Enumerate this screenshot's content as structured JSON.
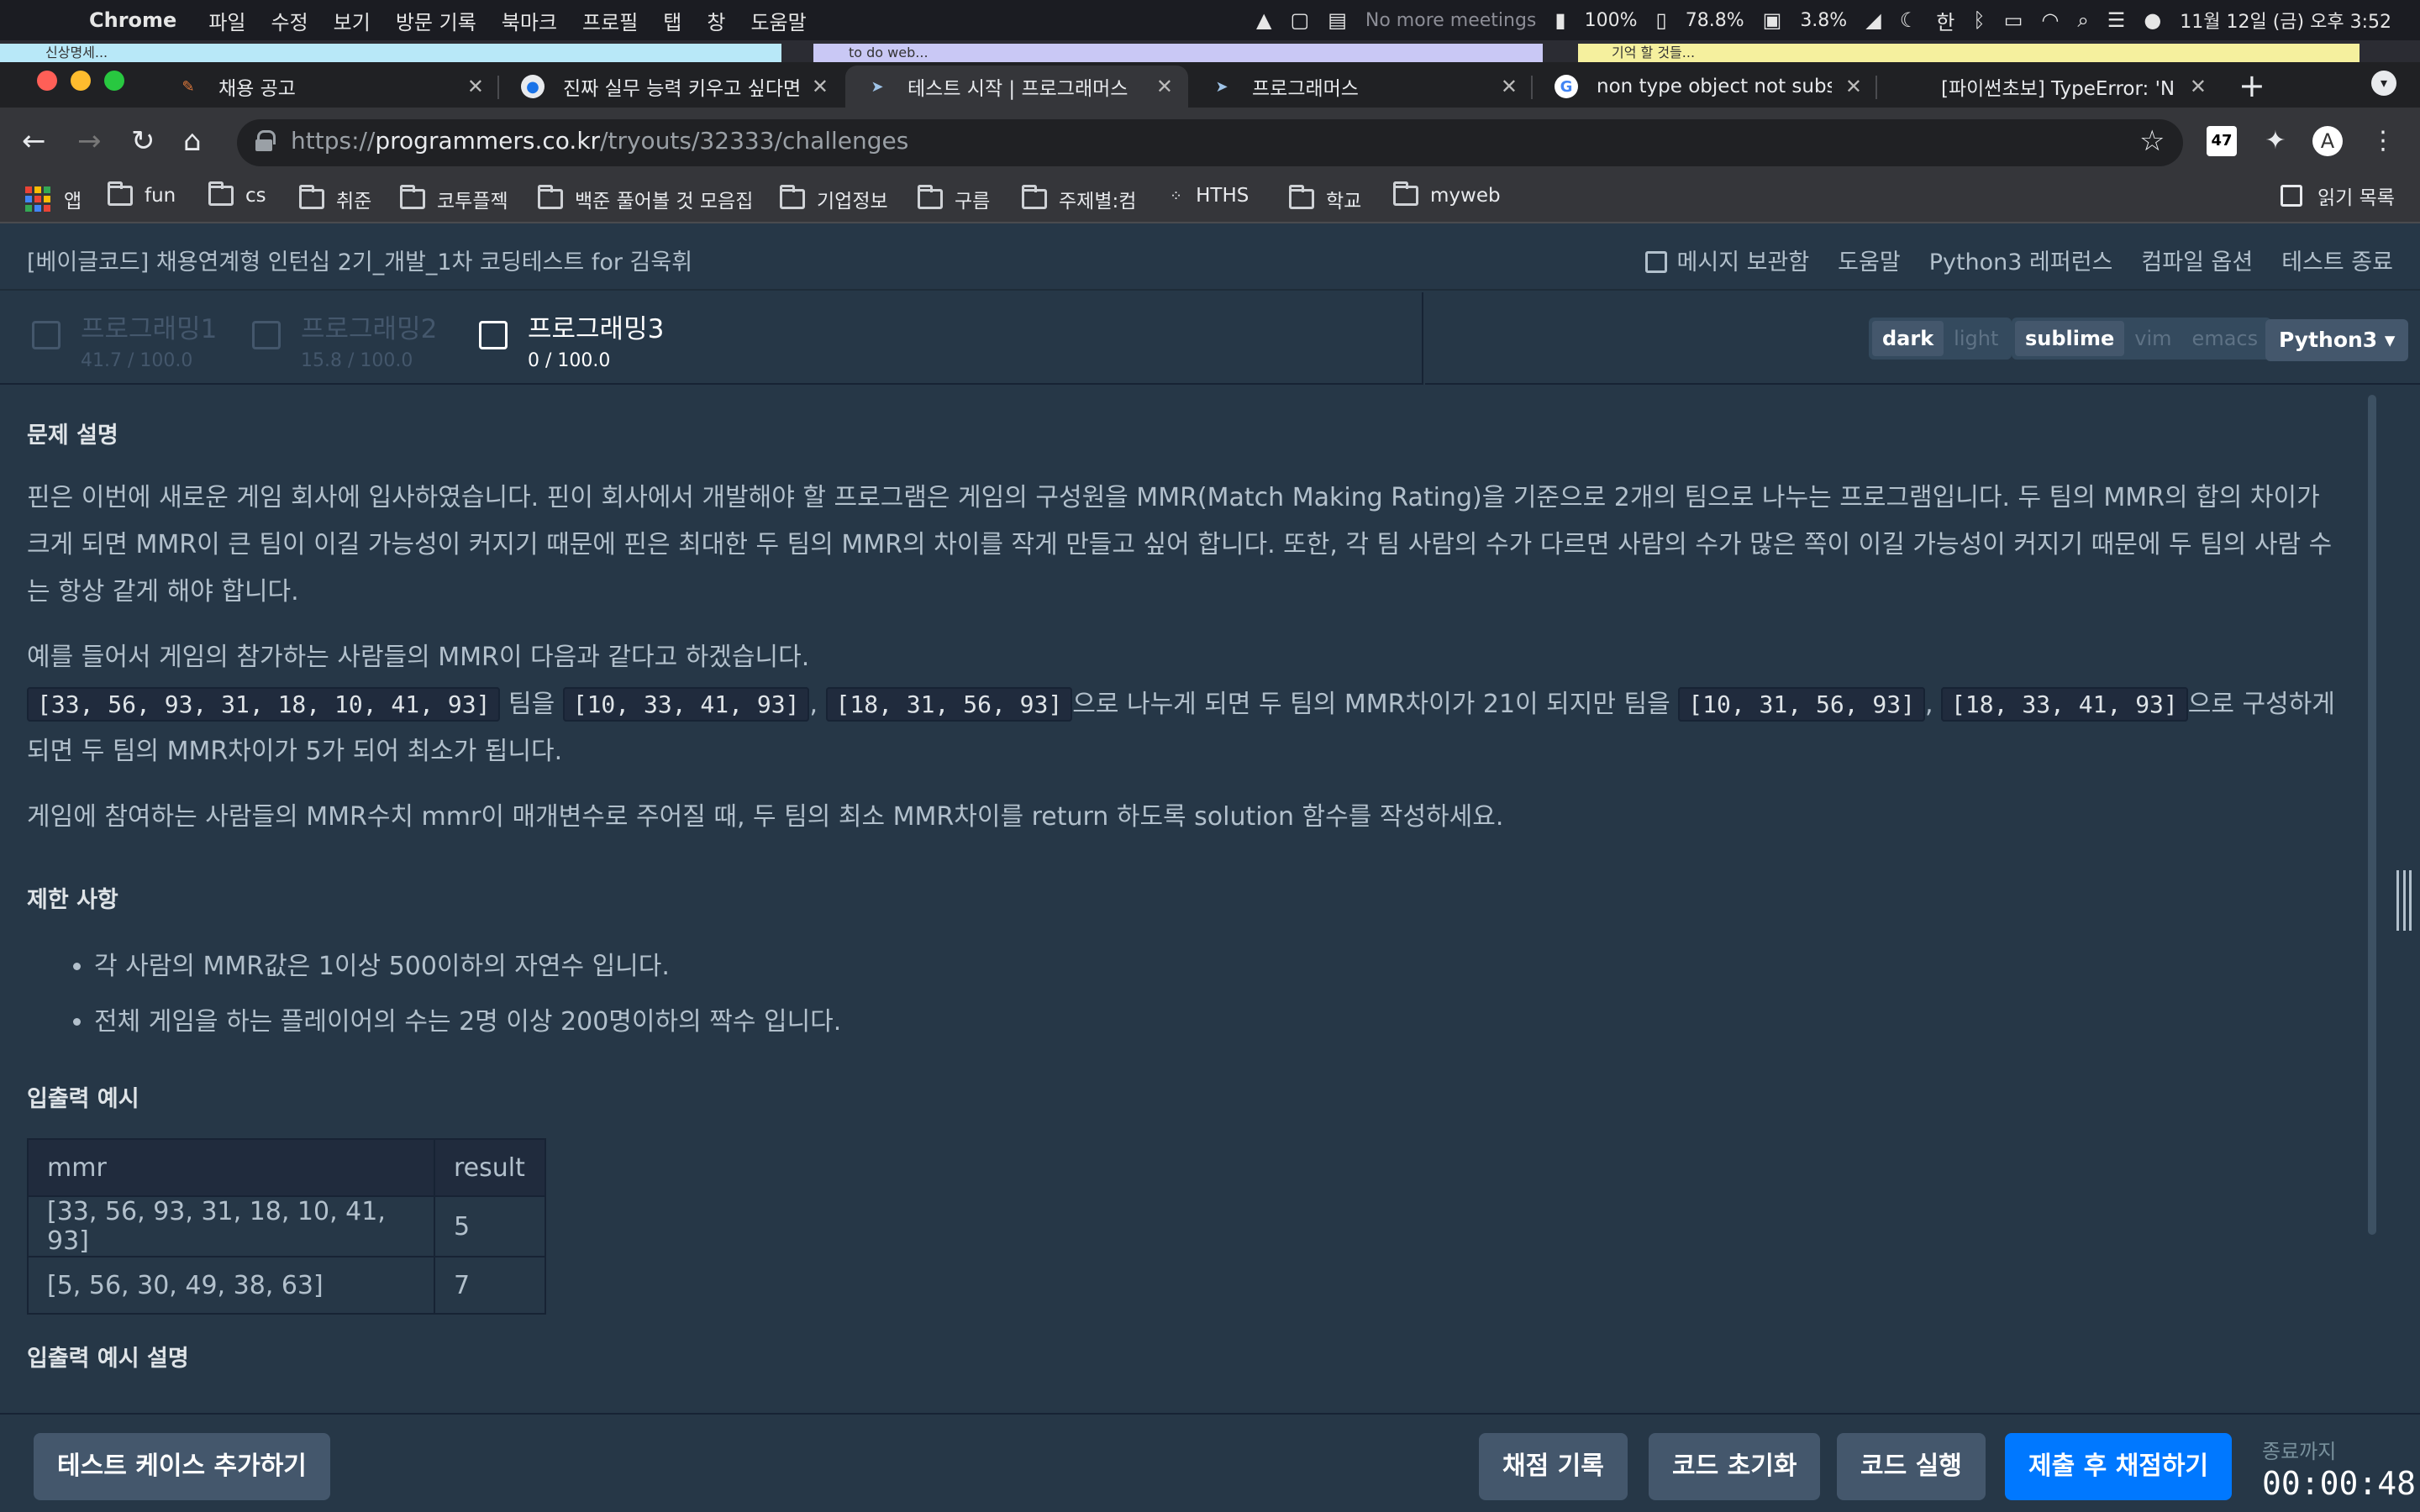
{
  "menubar": {
    "app": "Chrome",
    "items": [
      "파일",
      "수정",
      "보기",
      "방문 기록",
      "북마크",
      "프로필",
      "탭",
      "창",
      "도움말"
    ],
    "meeting_status": "No more meetings",
    "battery_pct": "100%",
    "memory_pct": "78.8%",
    "cpu_pct": "3.8%",
    "input_lang": "한",
    "datetime": "11월 12일 (금) 오후 3:52"
  },
  "stickies": [
    "신상명세...",
    "to do web...",
    "기억 할 것들..."
  ],
  "tabs": [
    {
      "title": "채용 공고",
      "active": false
    },
    {
      "title": "진짜 실무 능력 키우고 싶다면",
      "active": false
    },
    {
      "title": "테스트 시작 | 프로그래머스",
      "active": true
    },
    {
      "title": "프로그래머스",
      "active": false
    },
    {
      "title": "non type object not subs",
      "active": false
    },
    {
      "title": "[파이썬초보] TypeError: 'N",
      "active": false
    }
  ],
  "address": {
    "scheme": "https://",
    "host": "programmers.co.kr",
    "path": "/tryouts/32333/challenges"
  },
  "bookmarks": [
    "앱",
    "fun",
    "cs",
    "취준",
    "코투플젝",
    "백준 풀어볼 것 모음집",
    "기업정보",
    "구름",
    "주제별:컴",
    "HTHS",
    "학교",
    "myweb"
  ],
  "reading_list": "읽기 목록",
  "header": {
    "title": "[베이글코드] 채용연계형 인턴십 2기_개발_1차 코딩테스트 for 김욱휘",
    "links": [
      "메시지 보관함",
      "도움말",
      "Python3 레퍼런스",
      "컴파일 옵션",
      "테스트 종료"
    ]
  },
  "questions": [
    {
      "name": "프로그래밍1",
      "score": "41.7 / 100.0"
    },
    {
      "name": "프로그래밍2",
      "score": "15.8 / 100.0"
    },
    {
      "name": "프로그래밍3",
      "score": "0 / 100.0"
    }
  ],
  "editor": {
    "theme_options": [
      "dark",
      "light"
    ],
    "keymap_options": [
      "sublime",
      "vim",
      "emacs"
    ],
    "language": "Python3 ▾"
  },
  "problem": {
    "section_desc": "문제 설명",
    "para1": "핀은 이번에 새로운 게임 회사에 입사하였습니다. 핀이 회사에서 개발해야 할 프로그램은 게임의 구성원을 MMR(Match Making Rating)을 기준으로 2개의 팀으로 나누는 프로그램입니다. 두 팀의 MMR의 합의 차이가 크게 되면 MMR이 큰 팀이 이길 가능성이 커지기 때문에 핀은 최대한 두 팀의 MMR의 차이를 작게 만들고 싶어 합니다. 또한, 각 팀 사람의 수가 다르면 사람의 수가 많은 쪽이 이길 가능성이 커지기 때문에 두 팀의 사람 수는 항상 같게 해야 합니다.",
    "example_intro": "예를 들어서 게임의 참가하는 사람들의 MMR이 다음과 같다고 하겠습니다.",
    "ex_all": "[33, 56, 93, 31, 18, 10, 41, 93]",
    "ex_t1": " 팀을 ",
    "ex_a": "[10, 33, 41, 93]",
    "comma": ", ",
    "ex_b": "[18, 31, 56, 93]",
    "ex_t2": "으로 나누게 되면 두 팀의 MMR차이가 21이 되지만 팀을 ",
    "ex_c": "[10, 31, 56, 93]",
    "ex_d": "[18, 33, 41, 93]",
    "ex_t3": "으로 구성하게 되면 두 팀의 MMR차이가 5가 되어 최소가 됩니다.",
    "task": "게임에 참여하는 사람들의 MMR수치 mmr이 매개변수로 주어질 때, 두 팀의 최소 MMR차이를 return 하도록 solution 함수를 작성하세요.",
    "section_limits": "제한 사항",
    "limits": [
      "각 사람의 MMR값은 1이상 500이하의 자연수 입니다.",
      "전체 게임을 하는 플레이어의 수는 2명 이상 200명이하의 짝수 입니다."
    ],
    "section_io": "입출력 예시",
    "table_headers": [
      "mmr",
      "result"
    ],
    "table_rows": [
      [
        "[33, 56, 93, 31, 18, 10, 41, 93]",
        "5"
      ],
      [
        "[5, 56, 30, 49, 38, 63]",
        "7"
      ]
    ],
    "section_io_desc": "입출력 예시 설명"
  },
  "footer": {
    "add_case": "테스트 케이스 추가하기",
    "history": "채점 기록",
    "reset": "코드 초기화",
    "run": "코드 실행",
    "submit": "제출 후 채점하기",
    "timer_label": "종료까지",
    "timer": "00:00:48"
  },
  "colors": {
    "background": "#263747",
    "primary_button": "#0078ff",
    "secondary_button": "#44576c"
  }
}
